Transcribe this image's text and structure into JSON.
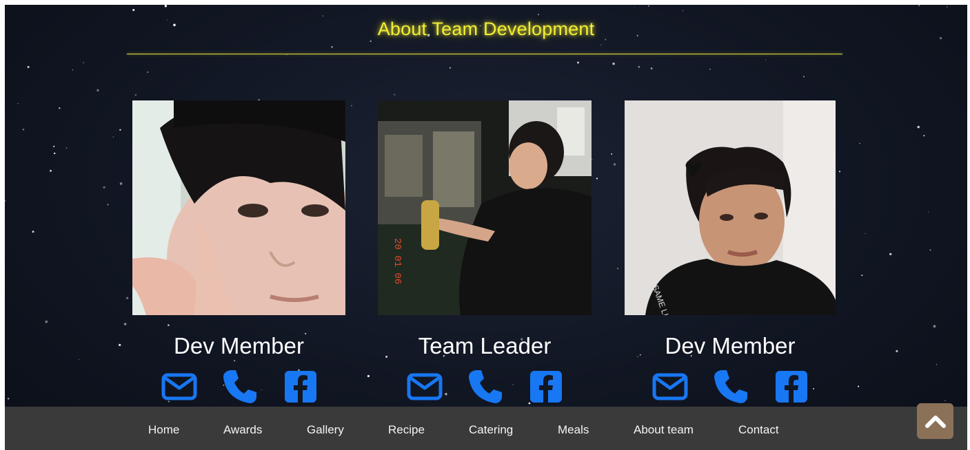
{
  "section": {
    "title": "About Team Development"
  },
  "members": [
    {
      "role": "Dev Member",
      "photo": "member-photo-1"
    },
    {
      "role": "Team Leader",
      "photo": "member-photo-2"
    },
    {
      "role": "Dev Member",
      "photo": "member-photo-3"
    }
  ],
  "icons": {
    "email": "envelope-icon",
    "phone": "phone-icon",
    "facebook": "facebook-icon",
    "top": "chevron-up-icon"
  },
  "colors": {
    "heading": "#f2ee34",
    "icon": "#1877f2",
    "footer": "#3a3a3a",
    "back_to_top": "#8a7158"
  },
  "footer": {
    "nav": [
      "Home",
      "Awards",
      "Gallery",
      "Recipe",
      "Catering",
      "Meals",
      "About team",
      "Contact"
    ]
  }
}
